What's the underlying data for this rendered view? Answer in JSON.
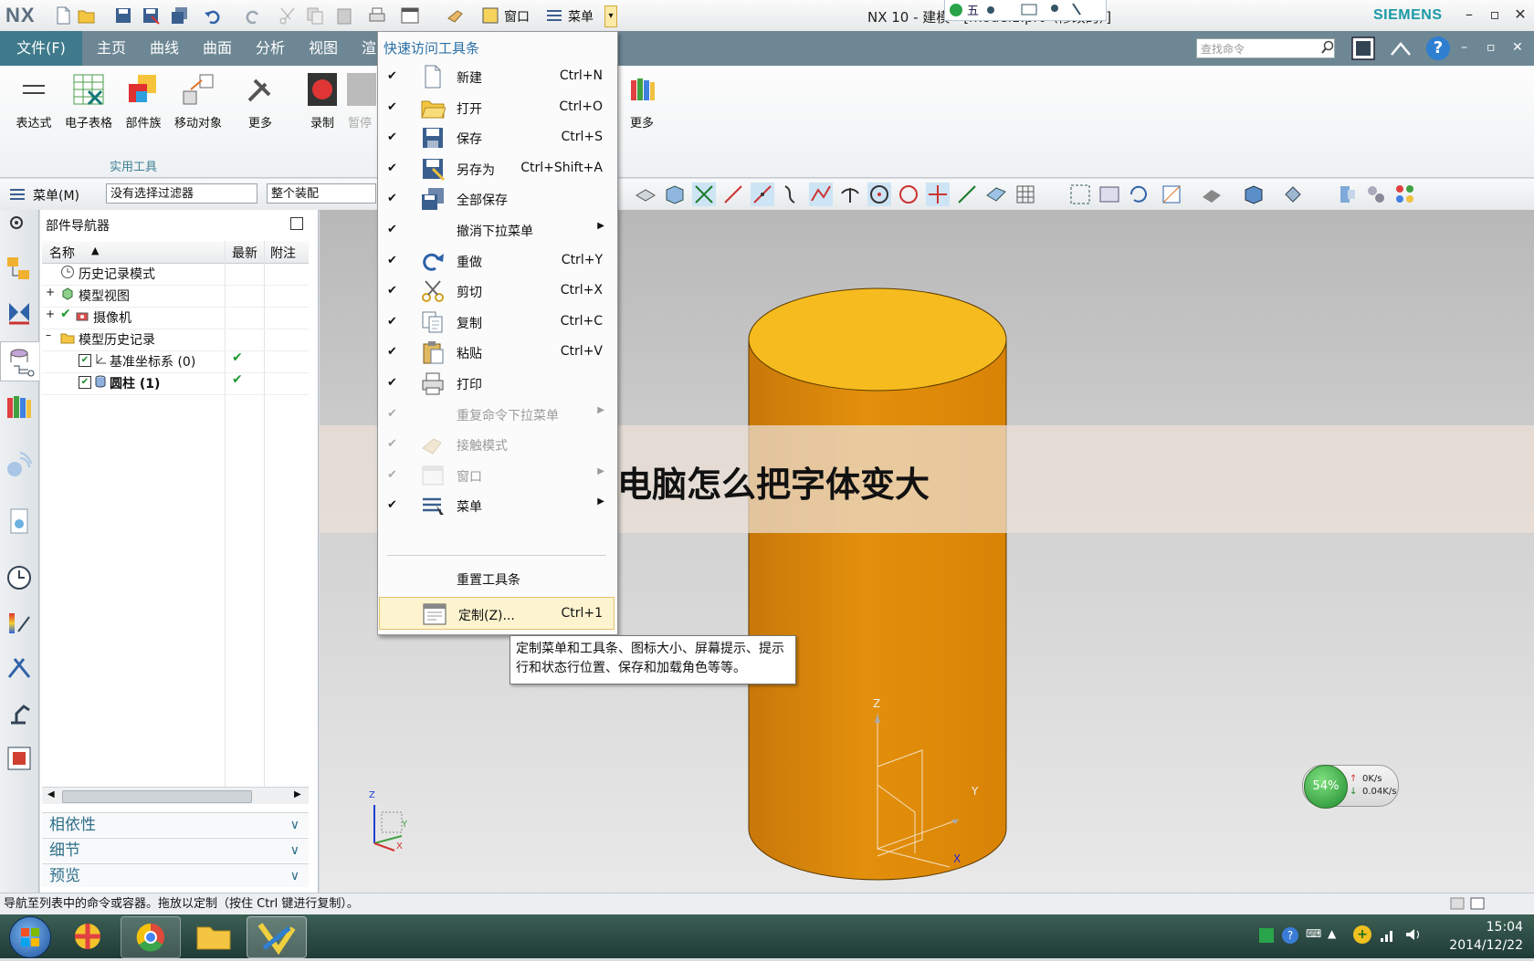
{
  "app": {
    "logo": "NX",
    "window_title": "NX 10 - 建模 - [model1.prt（修改的）]",
    "brand": "SIEMENS",
    "window_controls": [
      "–",
      "▫",
      "✕"
    ]
  },
  "quick_toolbar": {
    "window_label": "窗口",
    "menu_label": "菜单"
  },
  "ribbon_tabs": {
    "file": "文件(F)",
    "tabs": [
      "主页",
      "曲线",
      "曲面",
      "分析",
      "视图",
      "渲"
    ]
  },
  "command_search": {
    "placeholder": "查找命令"
  },
  "ribbon": {
    "buttons": [
      "表达式",
      "电子表格",
      "部件族",
      "移动对象",
      "更多",
      "录制",
      "暂停",
      "更多"
    ],
    "group_name": "实用工具"
  },
  "toolbar2": {
    "menu_button": "菜单(M)",
    "filter": "没有选择过滤器",
    "scope": "整个装配"
  },
  "navigator": {
    "title": "部件导航器",
    "columns": [
      "名称",
      "最新",
      "附注"
    ],
    "rows": [
      {
        "label": "历史记录模式",
        "bold": false
      },
      {
        "label": "模型视图",
        "bold": false
      },
      {
        "label": "摄像机",
        "bold": false
      },
      {
        "label": "模型历史记录",
        "bold": false
      },
      {
        "label": "基准坐标系 (0)",
        "bold": false
      },
      {
        "label": "圆柱 (1)",
        "bold": true
      }
    ],
    "panels": [
      "相依性",
      "细节",
      "预览"
    ]
  },
  "dropdown": {
    "header": "快速访问工具条",
    "items": [
      {
        "label": "新建",
        "shortcut": "Ctrl+N",
        "icon": "new-file-icon",
        "checked": true,
        "disabled": false,
        "submenu": false
      },
      {
        "label": "打开",
        "shortcut": "Ctrl+O",
        "icon": "open-folder-icon",
        "checked": true,
        "disabled": false,
        "submenu": false
      },
      {
        "label": "保存",
        "shortcut": "Ctrl+S",
        "icon": "save-icon",
        "checked": true,
        "disabled": false,
        "submenu": false
      },
      {
        "label": "另存为",
        "shortcut": "Ctrl+Shift+A",
        "icon": "save-as-icon",
        "checked": true,
        "disabled": false,
        "submenu": false
      },
      {
        "label": "全部保存",
        "shortcut": "",
        "icon": "save-all-icon",
        "checked": true,
        "disabled": false,
        "submenu": false
      },
      {
        "label": "撤消下拉菜单",
        "shortcut": "",
        "icon": "",
        "checked": true,
        "disabled": false,
        "submenu": true
      },
      {
        "label": "重做",
        "shortcut": "Ctrl+Y",
        "icon": "redo-icon",
        "checked": true,
        "disabled": false,
        "submenu": false
      },
      {
        "label": "剪切",
        "shortcut": "Ctrl+X",
        "icon": "cut-icon",
        "checked": true,
        "disabled": false,
        "submenu": false
      },
      {
        "label": "复制",
        "shortcut": "Ctrl+C",
        "icon": "copy-icon",
        "checked": true,
        "disabled": false,
        "submenu": false
      },
      {
        "label": "粘贴",
        "shortcut": "Ctrl+V",
        "icon": "paste-icon",
        "checked": true,
        "disabled": false,
        "submenu": false
      },
      {
        "label": "打印",
        "shortcut": "",
        "icon": "print-icon",
        "checked": true,
        "disabled": false,
        "submenu": false
      },
      {
        "label": "重复命令下拉菜单",
        "shortcut": "",
        "icon": "",
        "checked": true,
        "disabled": true,
        "submenu": true
      },
      {
        "label": "接触模式",
        "shortcut": "",
        "icon": "touch-mode-icon",
        "checked": true,
        "disabled": true,
        "submenu": false
      },
      {
        "label": "窗口",
        "shortcut": "",
        "icon": "window-icon",
        "checked": true,
        "disabled": true,
        "submenu": true
      },
      {
        "label": "菜单",
        "shortcut": "",
        "icon": "menu-icon",
        "checked": true,
        "disabled": false,
        "submenu": true
      }
    ],
    "reset": "重置工具条",
    "customize": {
      "label": "定制(Z)...",
      "shortcut": "Ctrl+1"
    }
  },
  "tooltip": "定制菜单和工具条、图标大小、屏幕提示、提示行和状态行位置、保存和加载角色等等。",
  "banner": "电脑怎么把字体变大",
  "viewport": {
    "axis_labels": [
      "Z",
      "Y",
      "X"
    ],
    "triad_labels": [
      "Z",
      "Y",
      "X"
    ]
  },
  "net_widget": {
    "percent": "54%",
    "up": "0K/s",
    "down": "0.04K/s"
  },
  "status_bar": "导航至列表中的命令或容器。拖放以定制（按住 Ctrl 键进行复制）。",
  "taskbar": {
    "time": "15:04",
    "date": "2014/12/22"
  },
  "colors": {
    "cylinder_top": "#f6bb1e",
    "cylinder_side": "#e08f06",
    "ribbon_tab": "#6e8794",
    "file_tab": "#3e7a8b",
    "accent": "#1a9aa5"
  }
}
